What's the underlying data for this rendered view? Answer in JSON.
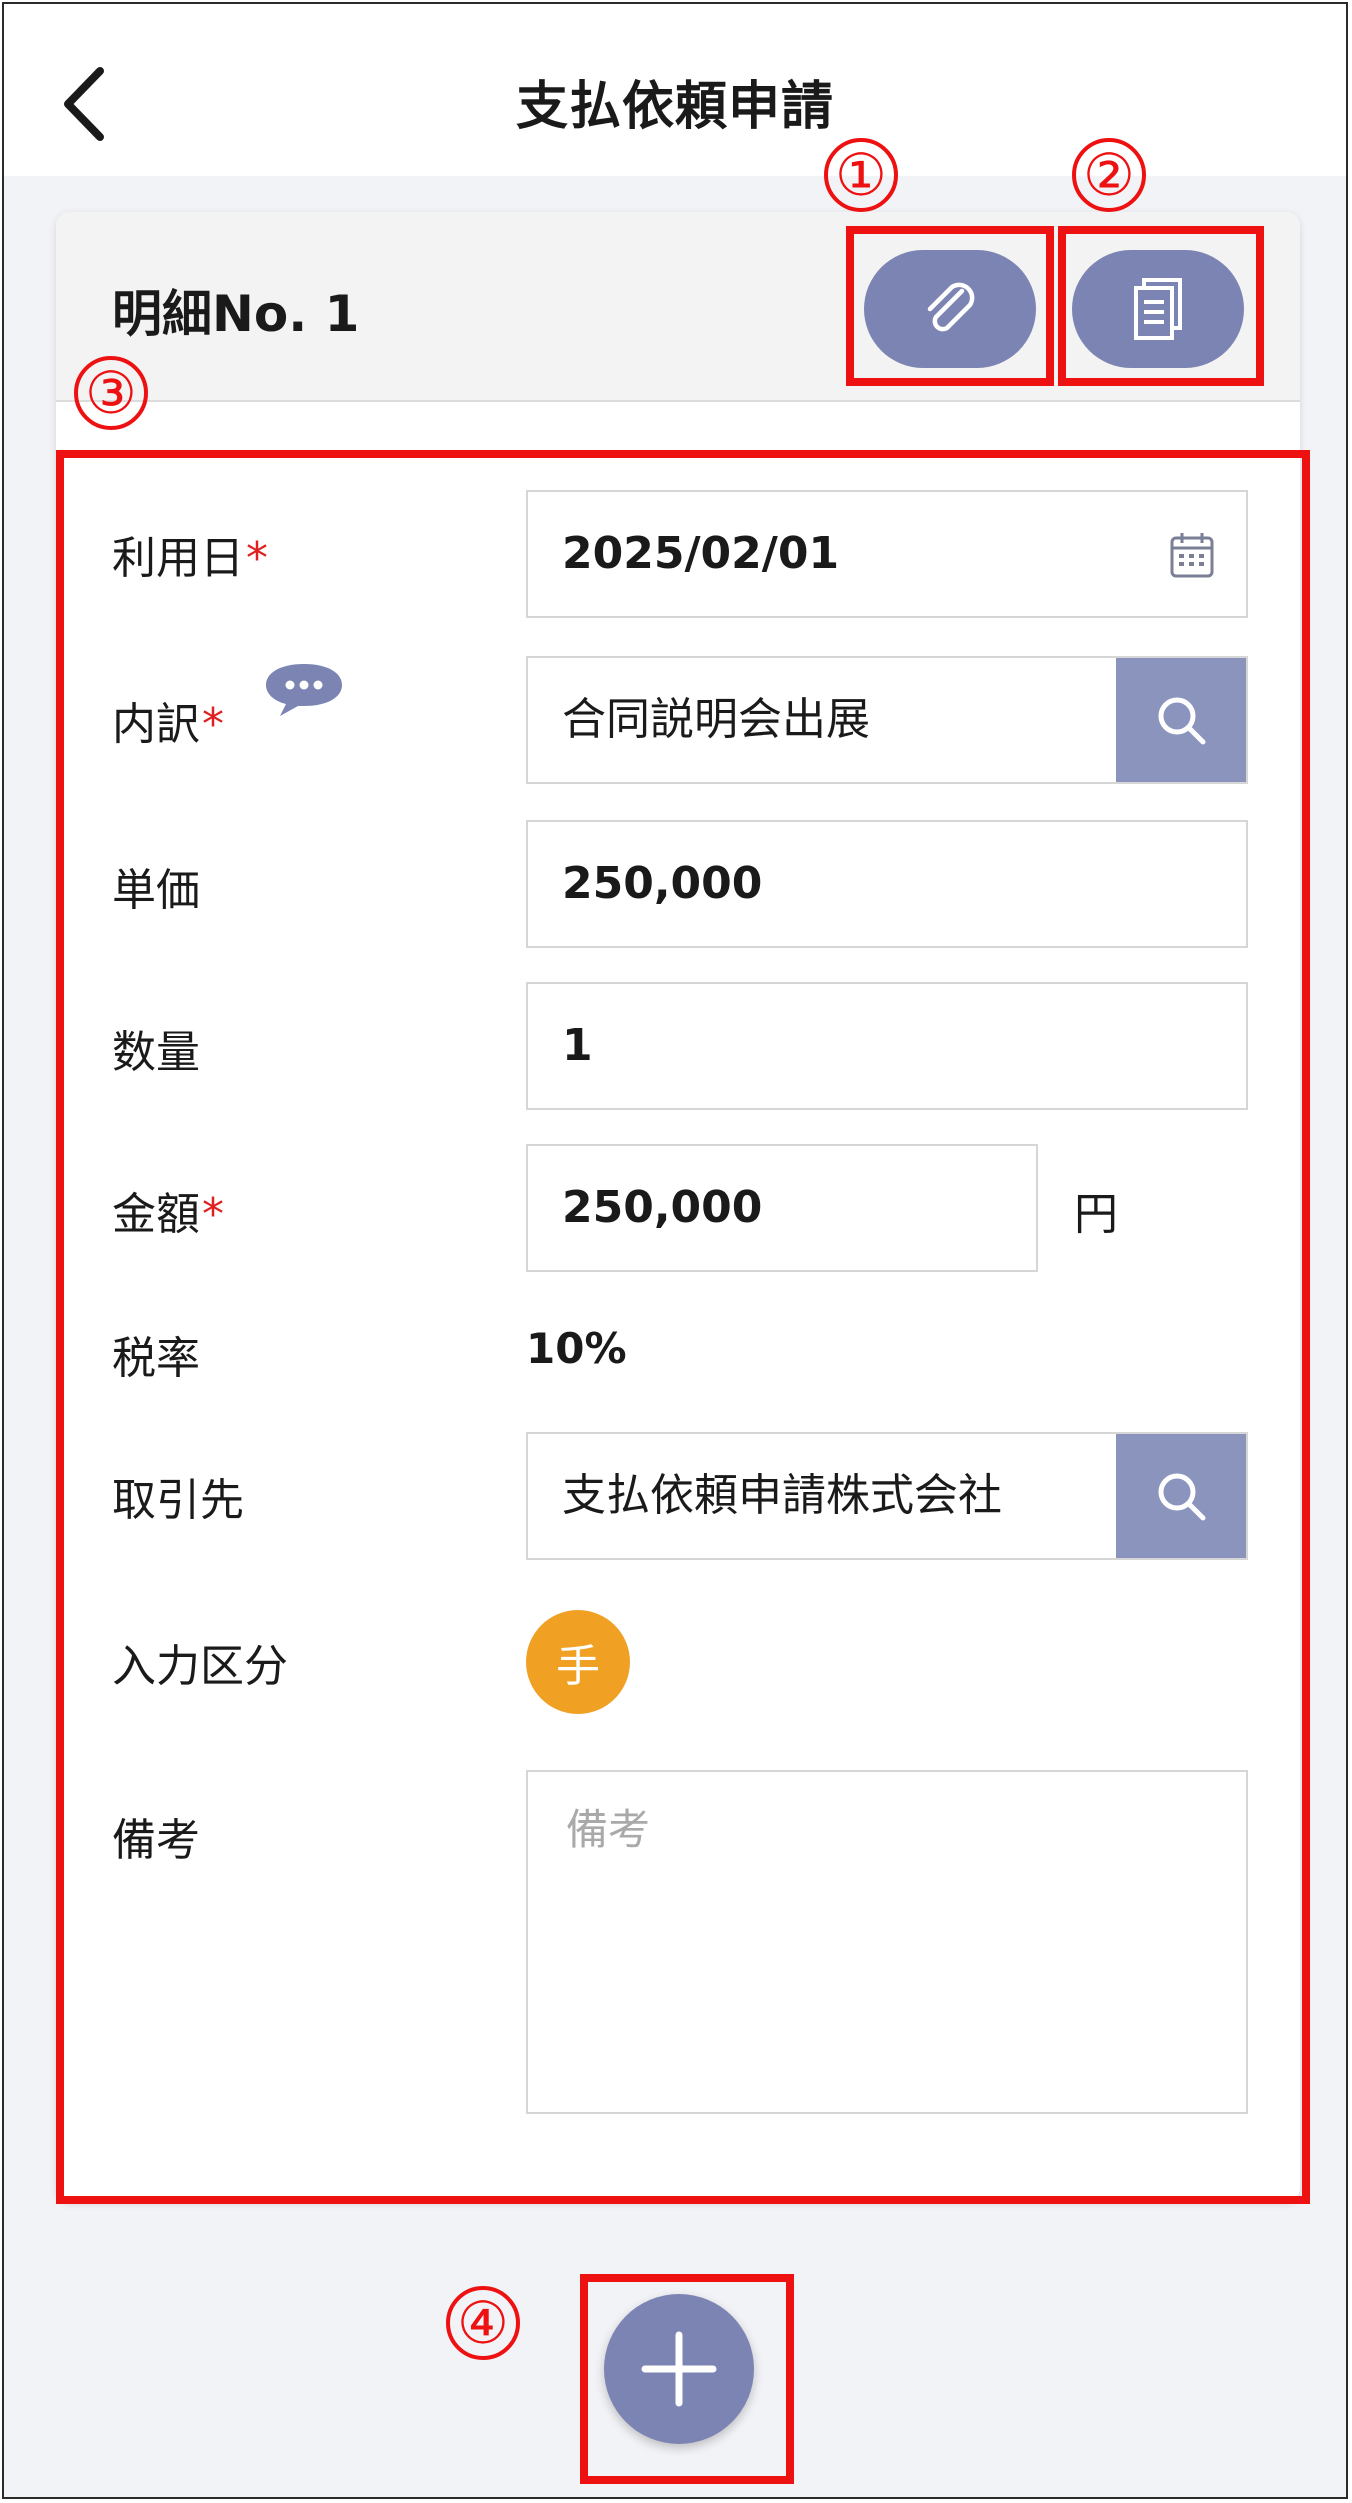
{
  "header": {
    "title": "支払依頼申請",
    "back_icon": "chevron-left-icon"
  },
  "card": {
    "title": "明細No. 1",
    "attach_icon": "paperclip-icon",
    "document_icon": "document-icon"
  },
  "annotations": {
    "n1": "①",
    "n2": "②",
    "n3": "③",
    "n4": "④"
  },
  "form": {
    "required_mark": "*",
    "usage_date": {
      "label": "利用日",
      "value": "2025/02/01"
    },
    "breakdown": {
      "label": "内訳",
      "value": "合同説明会出展"
    },
    "unit_price": {
      "label": "単価",
      "value": "250,000"
    },
    "quantity": {
      "label": "数量",
      "value": "1"
    },
    "amount": {
      "label": "金額",
      "value": "250,000",
      "unit": "円"
    },
    "tax_rate": {
      "label": "税率",
      "value": "10%"
    },
    "vendor": {
      "label": "取引先",
      "value": "支払依頼申請株式会社"
    },
    "input_type": {
      "label": "入力区分",
      "badge": "手"
    },
    "memo": {
      "label": "備考",
      "placeholder": "備考"
    }
  },
  "colors": {
    "accent": "#7b84b3",
    "search": "#8a94bd",
    "required": "#e02020",
    "annotation": "#ee1111",
    "badge": "#f0a023"
  }
}
